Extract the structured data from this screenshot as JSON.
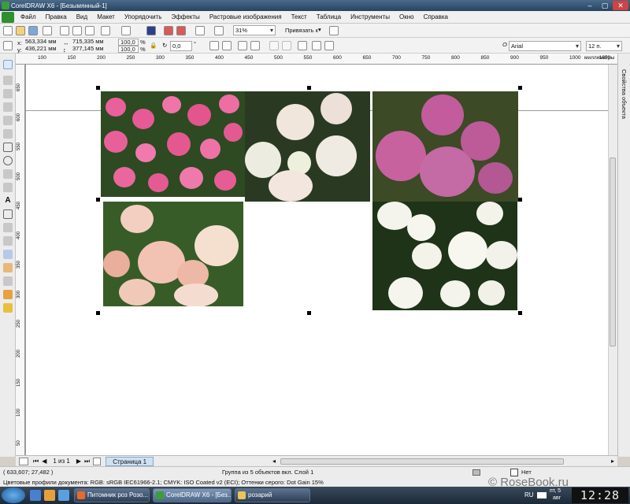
{
  "window": {
    "title": "CorelDRAW X6 - [Безымянный-1]",
    "min": "–",
    "max": "▢",
    "close": "✕"
  },
  "menu": [
    "Файл",
    "Правка",
    "Вид",
    "Макет",
    "Упорядочить",
    "Эффекты",
    "Растровые изображения",
    "Текст",
    "Таблица",
    "Инструменты",
    "Окно",
    "Справка"
  ],
  "toolbar1": {
    "zoom": "31%",
    "snap": "Привязать к"
  },
  "toolbar2": {
    "x_label": "x:",
    "x_value": "563,334 мм",
    "y_label": "y:",
    "y_value": "436,221 мм",
    "w_value": "715,335 мм",
    "h_value": "377,145 мм",
    "scale_w": "100,0",
    "scale_h": "100,0",
    "pct": "%",
    "rotation": "0,0",
    "degree": "°",
    "font": "Arial",
    "font_size": "12 п."
  },
  "ruler": {
    "unit": "миллиметры",
    "h_ticks": [
      "100",
      "150",
      "200",
      "250",
      "300",
      "350",
      "400",
      "450",
      "500",
      "550",
      "600",
      "650",
      "700",
      "750",
      "800",
      "850",
      "900",
      "950",
      "1000",
      "1050"
    ],
    "v_ticks": [
      "650",
      "600",
      "550",
      "500",
      "450",
      "400",
      "350",
      "300",
      "250",
      "200",
      "150",
      "100",
      "50"
    ]
  },
  "docker": {
    "title": "Свойства объекта"
  },
  "pagebar": {
    "counter": "1 из 1",
    "page_tab": "Страница 1",
    "vunit": "миллиметры"
  },
  "status": {
    "coords": "( 633,607; 27,482 )",
    "info": "Группа из 5 объектов вкл. Слой 1",
    "fill": "Нет",
    "profiles": "Цветовые профили документа: RGB: sRGB IEC61966-2.1; CMYK: ISO Coated v2 (ECI); Оттенки серого: Dot Gain 15%"
  },
  "watermark": "© RoseBook.ru",
  "taskbar": {
    "tasks": [
      "Питомник роз Розо...",
      "CorelDRAW X6 - [Без...",
      "розарий"
    ],
    "lang": "RU",
    "date_day": "пт, 5",
    "date_month": "авг",
    "clock": "12:28"
  }
}
